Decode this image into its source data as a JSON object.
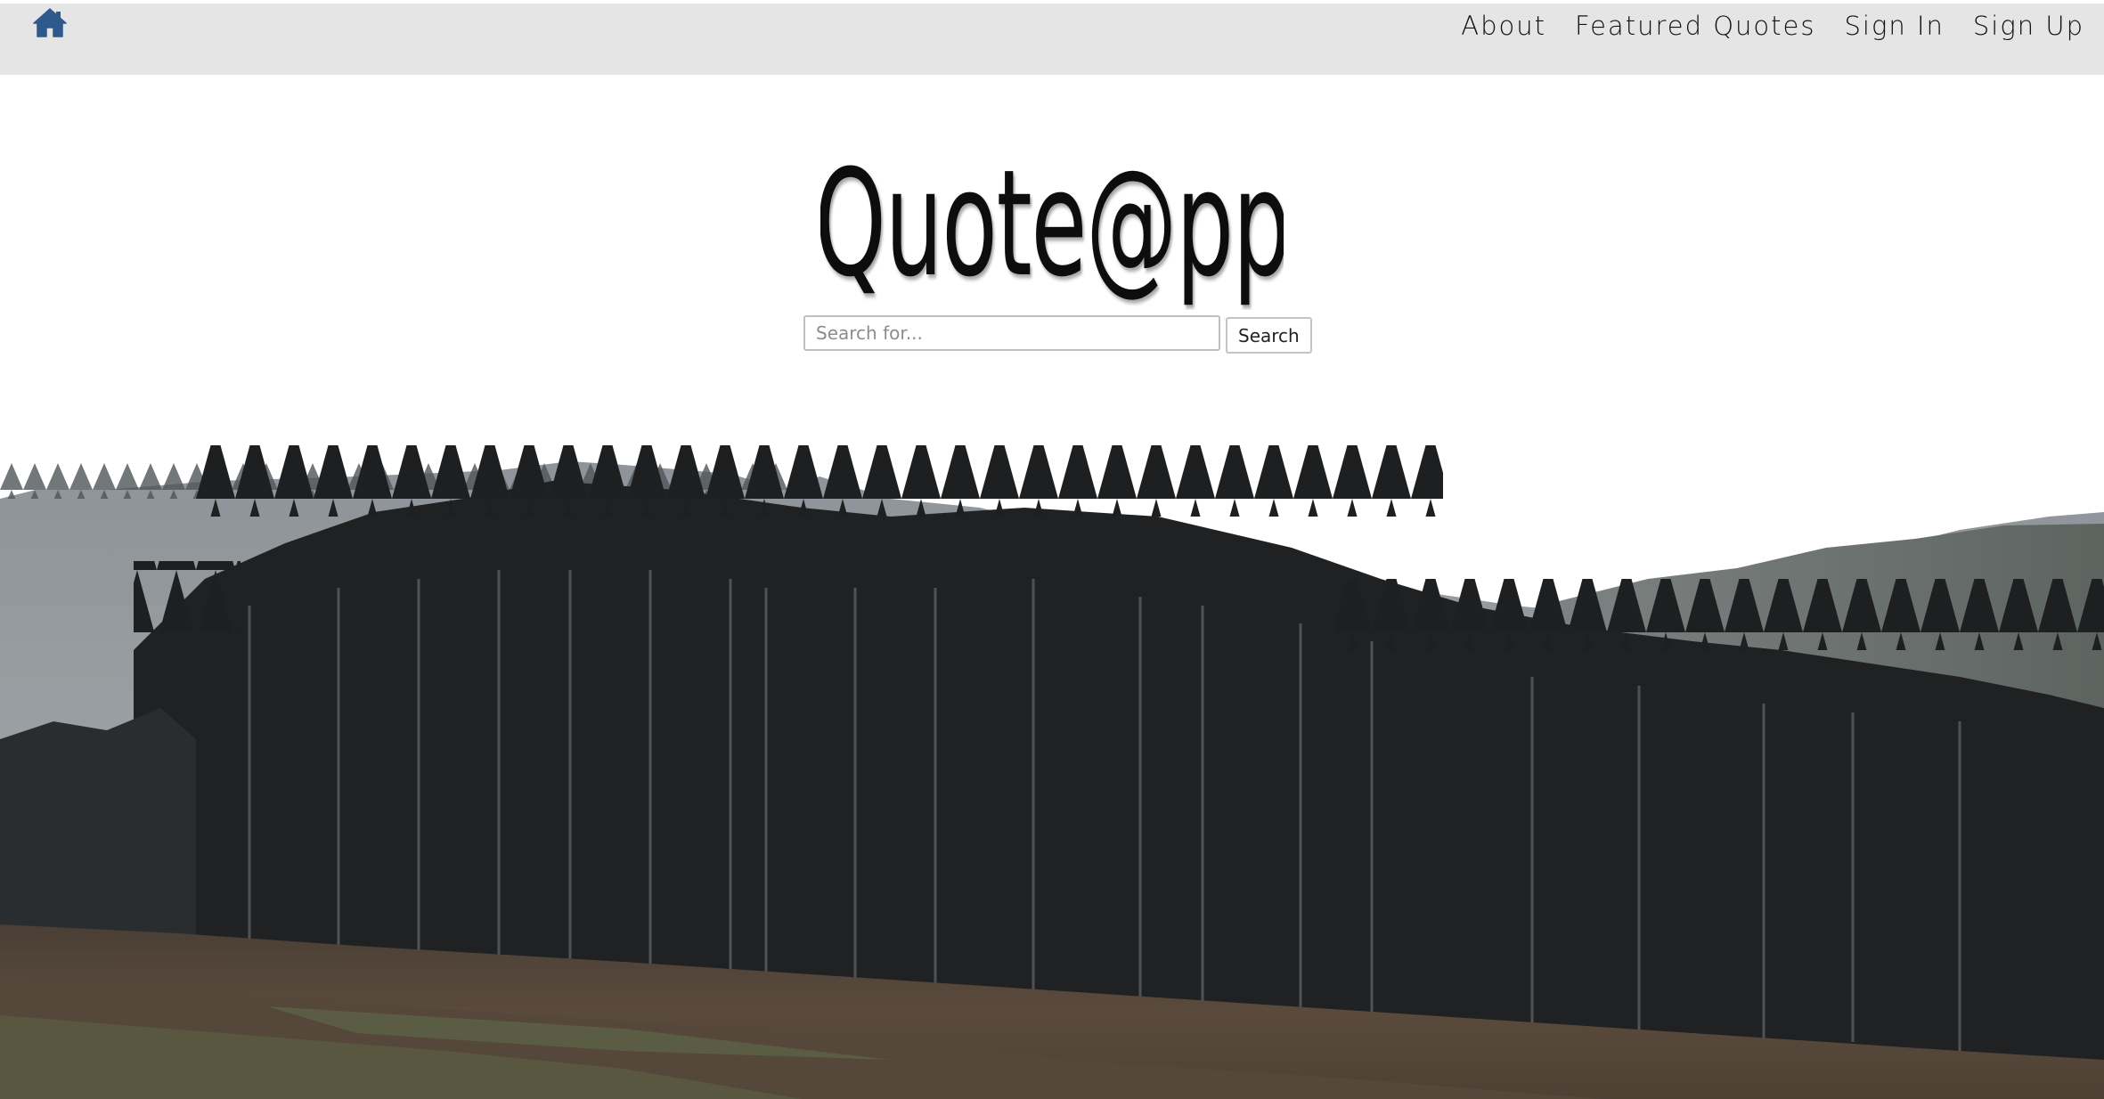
{
  "navbar": {
    "home_icon": "home-icon",
    "links": [
      "About",
      "Featured Quotes",
      "Sign In",
      "Sign Up"
    ]
  },
  "logo": {
    "text": "Quote@pp"
  },
  "search": {
    "placeholder": "Search for...",
    "value": "",
    "button_label": "Search"
  },
  "hero": {
    "image": "misty forest hillside with dark pine trees above a brown field"
  },
  "colors": {
    "navbar_bg": "#e5e5e5",
    "home_icon": "#2d5a8a",
    "nav_text": "#111111",
    "page_bg": "#ffffff"
  }
}
